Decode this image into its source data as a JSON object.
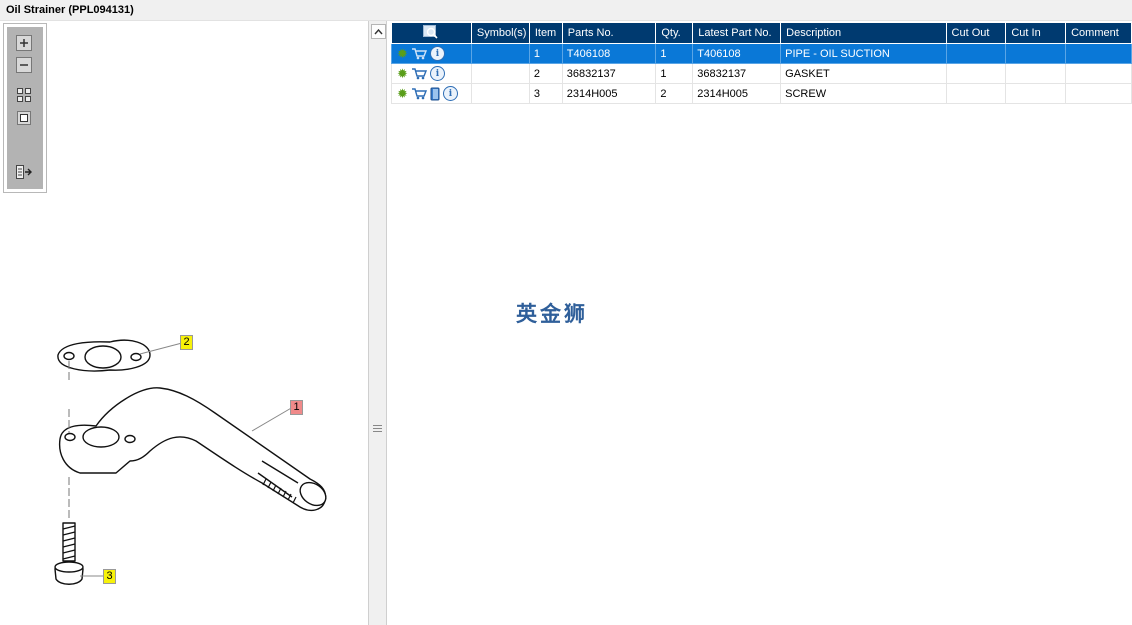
{
  "window": {
    "title": "Oil Strainer (PPL094131)"
  },
  "toolbox": {
    "zoom_in_icon": "plus-icon",
    "zoom_out_icon": "minus-icon",
    "fit_icon": "fit-grid-icon",
    "actual_size_icon": "square-icon",
    "export_icon": "export-arrow-icon"
  },
  "diagram": {
    "callouts": [
      {
        "label": "2",
        "color": "#f7f20a"
      },
      {
        "label": "1",
        "color": "#f08a8a"
      },
      {
        "label": "3",
        "color": "#f7f20a"
      }
    ]
  },
  "table": {
    "headers": {
      "tools": "",
      "symbols": "Symbol(s)",
      "item": "Item",
      "parts_no": "Parts No.",
      "qty": "Qty.",
      "latest_part_no": "Latest Part No.",
      "description": "Description",
      "cut_out": "Cut Out",
      "cut_in": "Cut In",
      "comment": "Comment"
    },
    "rows": [
      {
        "item": "1",
        "parts_no": "T406108",
        "qty": "1",
        "latest_part_no": "T406108",
        "description": "PIPE - OIL SUCTION",
        "cut_out": "",
        "cut_in": "",
        "comment": "",
        "selected": true
      },
      {
        "item": "2",
        "parts_no": "36832137",
        "qty": "1",
        "latest_part_no": "36832137",
        "description": "GASKET",
        "cut_out": "",
        "cut_in": "",
        "comment": "",
        "selected": false
      },
      {
        "item": "3",
        "parts_no": "2314H005",
        "qty": "2",
        "latest_part_no": "2314H005",
        "description": "SCREW",
        "cut_out": "",
        "cut_in": "",
        "comment": "",
        "selected": false
      }
    ]
  },
  "watermark": "英金狮",
  "colors": {
    "header_bg": "#003a70",
    "selected_row": "#0a78d7",
    "gear": "#5a9e1a",
    "cart": "#2d6db5"
  }
}
